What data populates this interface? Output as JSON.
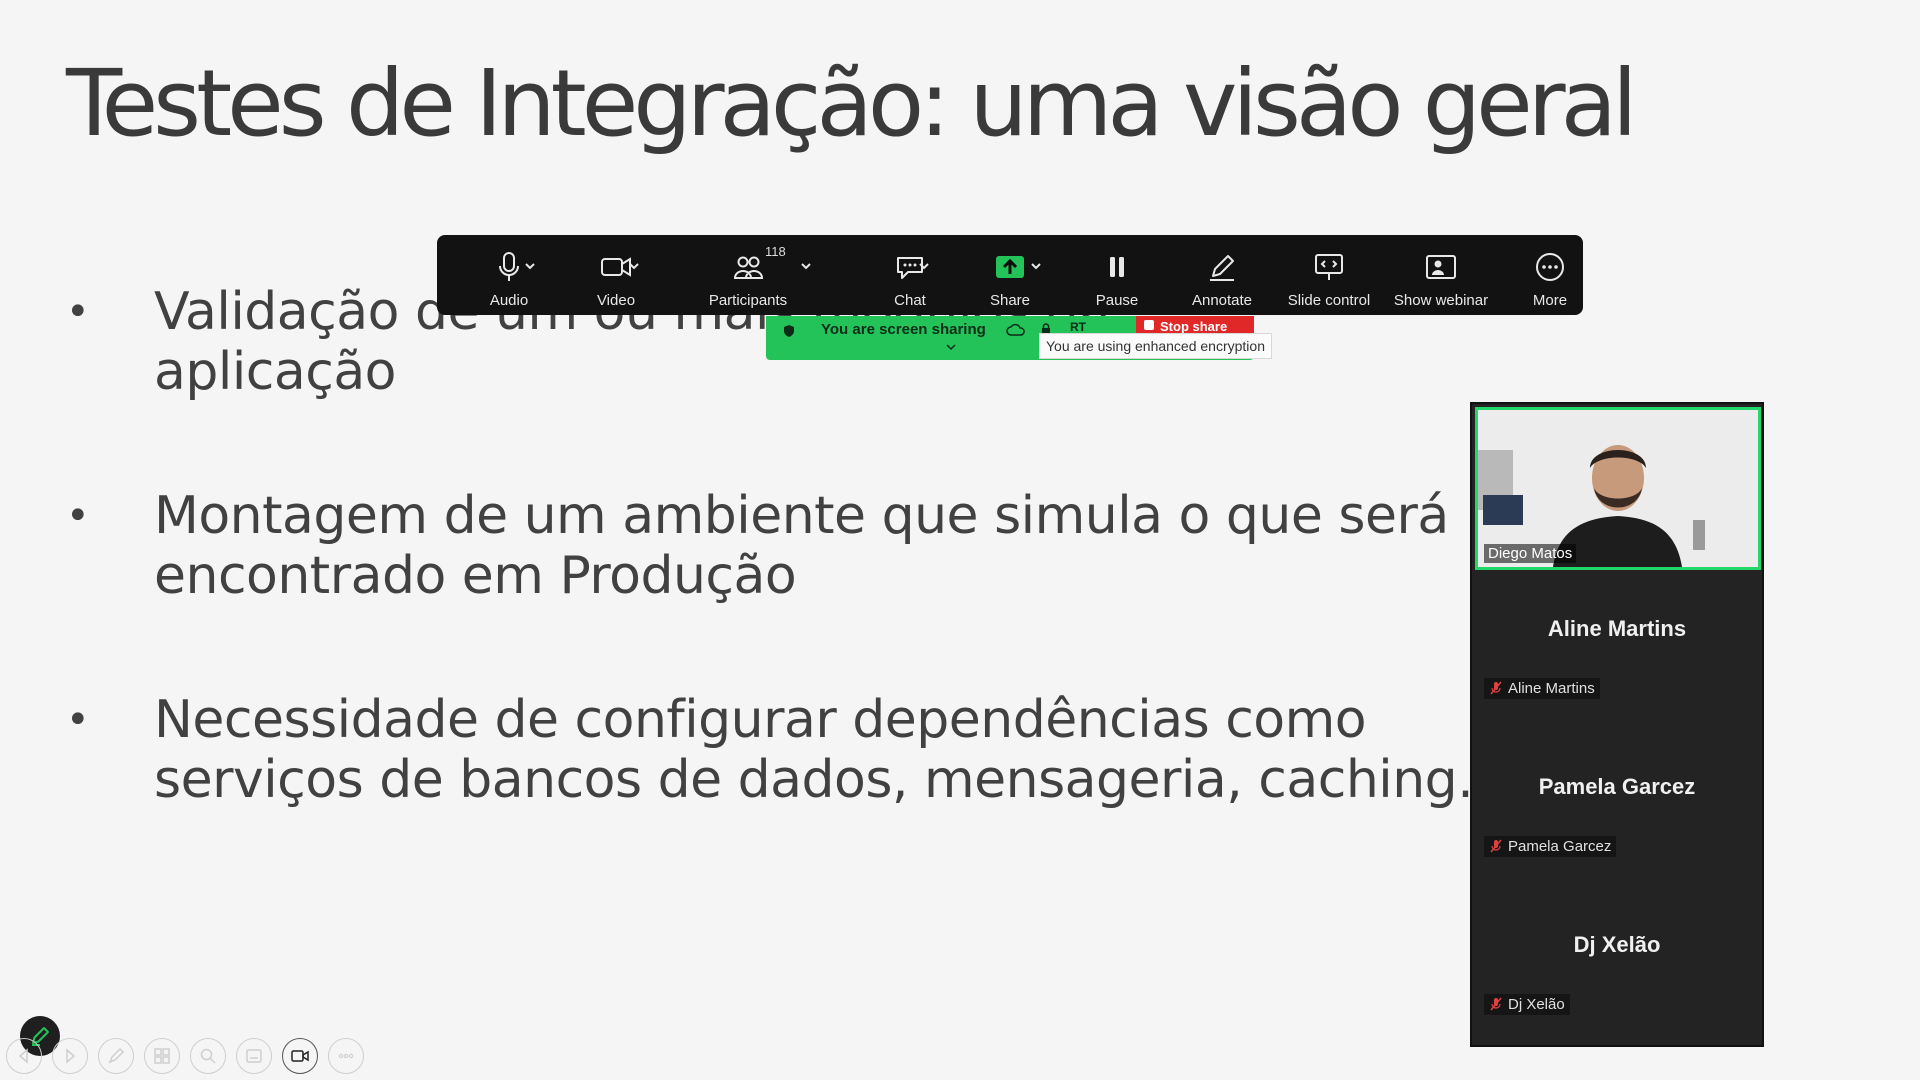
{
  "slide": {
    "title": "Testes de Integração: uma visão geral",
    "bullets": [
      {
        "line1": "Validação de um ou mais módulos da",
        "line2": "aplicação"
      },
      {
        "line1": "Montagem de um ambiente que simula o que será",
        "line2": "encontrado em Produção"
      },
      {
        "line1": "Necessidade de configurar dependências como",
        "line2": "serviços de bancos de dados, mensageria, caching..."
      }
    ]
  },
  "toolbar": {
    "audio": "Audio",
    "video": "Video",
    "participants": "Participants",
    "participants_count": "118",
    "chat": "Chat",
    "share": "Share",
    "pause": "Pause",
    "annotate": "Annotate",
    "slide_control": "Slide control",
    "show_webinar": "Show webinar",
    "more": "More"
  },
  "sharing": {
    "status": "You are screen sharing",
    "rt": "RT",
    "stop": "Stop share",
    "encryption_tooltip": "You are using enhanced encryption"
  },
  "participants": {
    "speaker": "Diego Matos",
    "others": [
      {
        "display": "Aline Martins",
        "label": "Aline Martins"
      },
      {
        "display": "Pamela Garcez",
        "label": "Pamela Garcez"
      },
      {
        "display": "Dj Xelão",
        "label": "Dj Xelão"
      }
    ]
  },
  "colors": {
    "accent_green": "#23c35a",
    "stop_red": "#e02828",
    "toolbar_bg": "#121212"
  }
}
